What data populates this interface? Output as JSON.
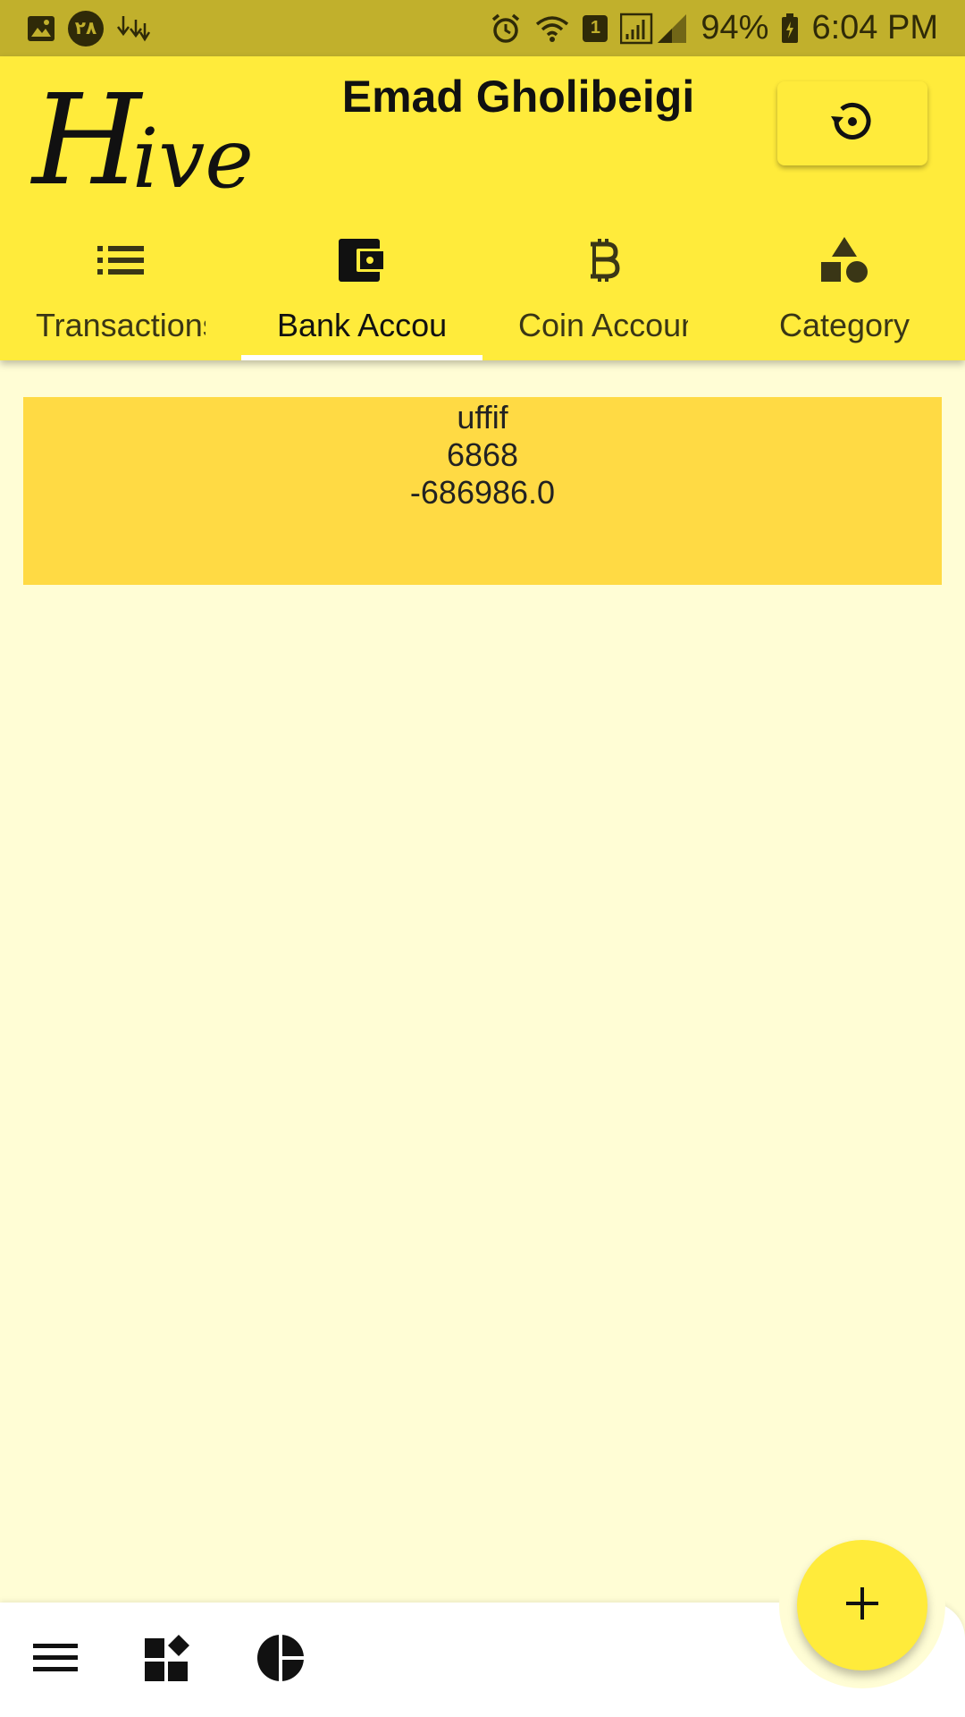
{
  "status_bar": {
    "notification_badge": "۲۸",
    "sim_badge": "1",
    "battery": "94%",
    "time": "6:04 PM",
    "icons": [
      "image-icon",
      "badge-icon",
      "download-icon",
      "alarm-icon",
      "wifi-icon",
      "sim-icon",
      "signal-icon",
      "battery-icon"
    ]
  },
  "header": {
    "logo_big": "H",
    "logo_small": "ive",
    "user_name": "Emad Gholibeigi",
    "reset_icon": "restore-icon"
  },
  "tabs": [
    {
      "label": "Transactions",
      "icon": "list-icon",
      "active": false
    },
    {
      "label": "Bank Accounts",
      "icon": "wallet-icon",
      "active": true
    },
    {
      "label": "Coin Accounts",
      "icon": "bitcoin-icon",
      "active": false
    },
    {
      "label": "Category",
      "icon": "category-icon",
      "active": false
    }
  ],
  "accounts": [
    {
      "name": "uffif",
      "number": "6868",
      "balance": "-686986.0"
    }
  ],
  "bottom_bar": {
    "items": [
      "menu-icon",
      "dashboard-icon",
      "pie-chart-icon"
    ],
    "fab_icon": "add-icon"
  },
  "colors": {
    "status_bar": "#C1B02C",
    "app_bar": "#FFEB3B",
    "background": "#FFFDD5",
    "card": "#FFDA44",
    "fab": "#FFEB3B"
  }
}
